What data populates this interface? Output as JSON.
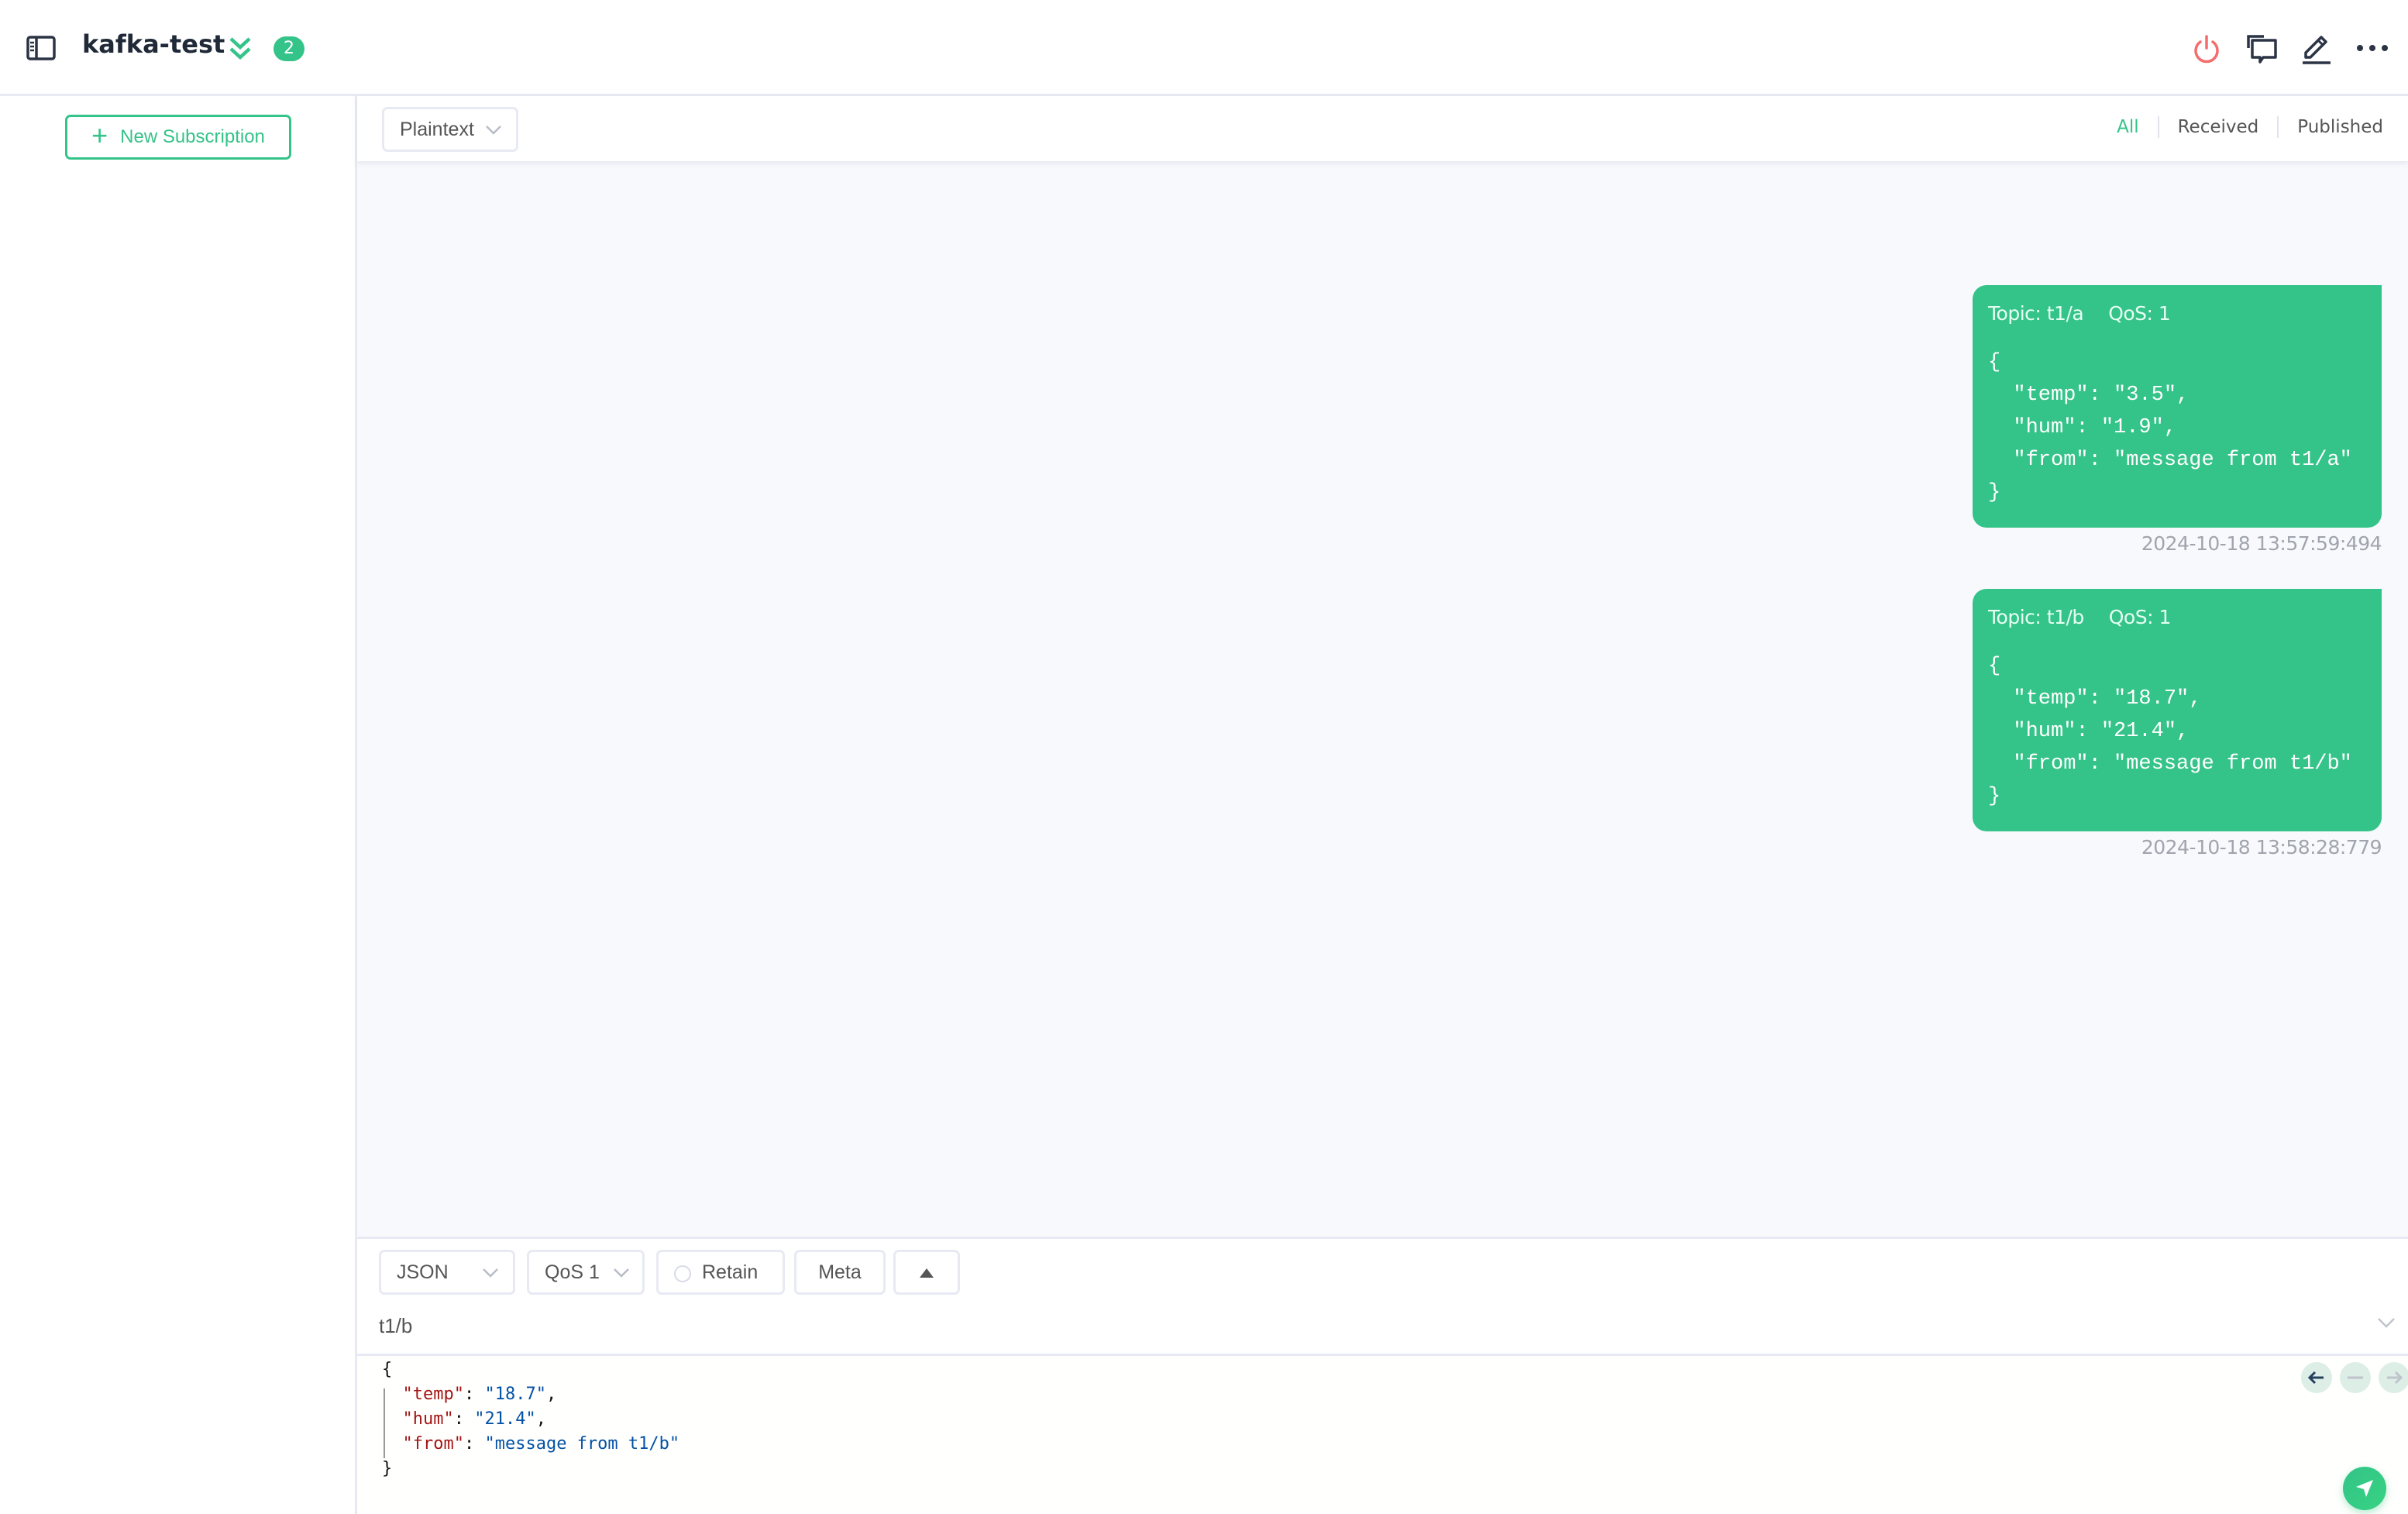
{
  "header": {
    "title": "kafka-test",
    "badge_count": "2",
    "icons": [
      "sidebar-toggle-icon",
      "collapse-icon",
      "disconnect-icon",
      "new-window-icon",
      "edit-icon",
      "more-icon"
    ]
  },
  "colors": {
    "accent": "#34c388",
    "danger": "#f56c6c",
    "message_bg": "#f8f9fd",
    "json_key": "#a31515",
    "json_value": "#0451a5"
  },
  "sidebar": {
    "new_subscription_label": "New Subscription"
  },
  "toolbar": {
    "payload_format": "Plaintext",
    "filters": [
      {
        "label": "All",
        "active": true
      },
      {
        "label": "Received",
        "active": false
      },
      {
        "label": "Published",
        "active": false
      }
    ]
  },
  "messages": [
    {
      "direction": "published",
      "topic_label": "Topic: t1/a",
      "qos_label": "QoS: 1",
      "payload": "{\n  \"temp\": \"3.5\",\n  \"hum\": \"1.9\",\n  \"from\": \"message from t1/a\"\n}",
      "timestamp": "2024-10-18 13:57:59:494"
    },
    {
      "direction": "published",
      "topic_label": "Topic: t1/b",
      "qos_label": "QoS: 1",
      "payload": "{\n  \"temp\": \"18.7\",\n  \"hum\": \"21.4\",\n  \"from\": \"message from t1/b\"\n}",
      "timestamp": "2024-10-18 13:58:28:779"
    }
  ],
  "publish": {
    "format": "JSON",
    "qos": "QoS 1",
    "retain_label": "Retain",
    "retain_checked": false,
    "meta_label": "Meta",
    "topic": "t1/b",
    "payload": {
      "open": "{",
      "close": "}",
      "lines": [
        {
          "key": "\"temp\"",
          "value": "\"18.7\"",
          "trail": ","
        },
        {
          "key": "\"hum\"",
          "value": "\"21.4\"",
          "trail": ","
        },
        {
          "key": "\"from\"",
          "value": "\"message from t1/b\"",
          "trail": ""
        }
      ]
    }
  }
}
